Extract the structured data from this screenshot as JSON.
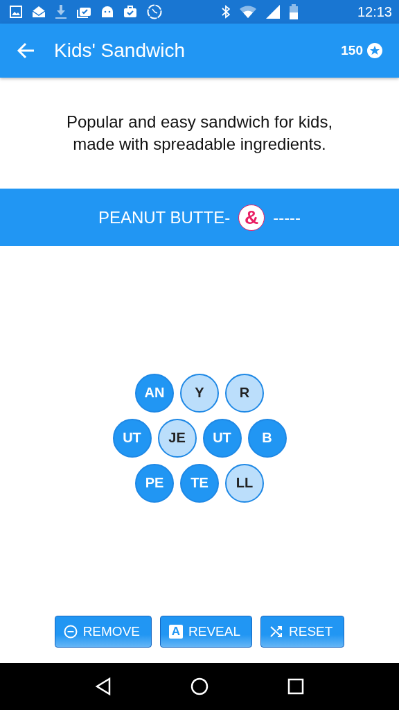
{
  "status_bar": {
    "time": "12:13"
  },
  "app_bar": {
    "title": "Kids' Sandwich",
    "score": "150"
  },
  "description": "Popular and easy sandwich for kids,\nmade with spreadable ingredients.",
  "answer": {
    "first": "PEANUT BUTTE-",
    "joiner": "&",
    "second": "-----"
  },
  "tile_rows": [
    [
      {
        "text": "AN",
        "used": true
      },
      {
        "text": "Y",
        "used": false
      },
      {
        "text": "R",
        "used": false
      }
    ],
    [
      {
        "text": "UT",
        "used": true
      },
      {
        "text": "JE",
        "used": false
      },
      {
        "text": "UT",
        "used": true
      },
      {
        "text": "B",
        "used": true
      }
    ],
    [
      {
        "text": "PE",
        "used": true
      },
      {
        "text": "TE",
        "used": true
      },
      {
        "text": "LL",
        "used": false
      }
    ]
  ],
  "buttons": [
    {
      "kind": "remove",
      "label": "REMOVE"
    },
    {
      "kind": "reveal",
      "label": "REVEAL",
      "icon_text": "A"
    },
    {
      "kind": "reset",
      "label": "RESET"
    }
  ]
}
